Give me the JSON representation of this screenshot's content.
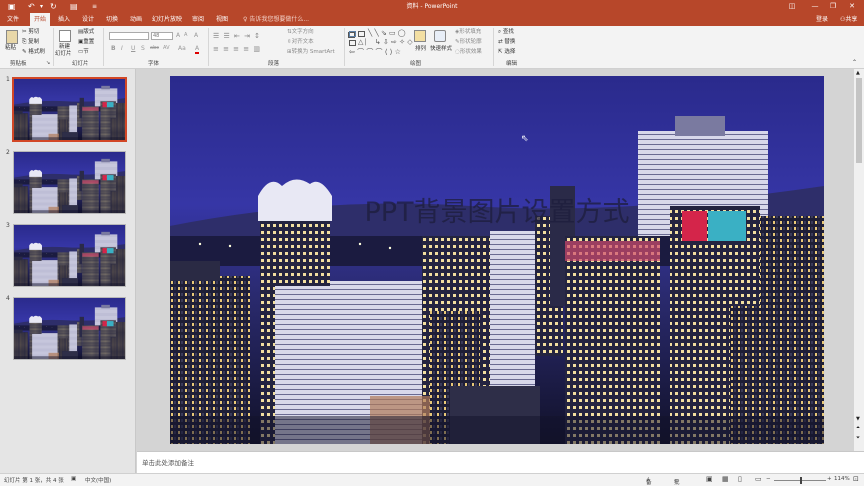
{
  "window": {
    "title": "資料 - PowerPoint"
  },
  "quick_access": {
    "save_icon": "save-icon",
    "undo_icon": "undo-icon",
    "redo_icon": "redo-icon",
    "customize_icon": "customize-icon"
  },
  "window_controls": {
    "ribbon_display": "ribbon-display-icon",
    "minimize": "minimize-icon",
    "restore": "restore-icon",
    "close": "close-icon"
  },
  "tabs": [
    {
      "label": "文件"
    },
    {
      "label": "开始"
    },
    {
      "label": "插入"
    },
    {
      "label": "设计"
    },
    {
      "label": "切换"
    },
    {
      "label": "动画"
    },
    {
      "label": "幻灯片放映"
    },
    {
      "label": "审阅"
    },
    {
      "label": "视图"
    }
  ],
  "tell_me": {
    "placeholder": "告诉我您想要做什么..."
  },
  "account": {
    "login": "登录",
    "share": "共享"
  },
  "ribbon": {
    "clipboard": {
      "paste": "粘贴",
      "cut": "剪切",
      "copy": "复制",
      "format_painter": "格式刷",
      "label": "剪贴板"
    },
    "slides": {
      "new_slide": "新建",
      "new_slide2": "幻灯片",
      "layout": "版式",
      "reset": "重置",
      "section": "节",
      "label": "幻灯片"
    },
    "font": {
      "name": "",
      "size": "48",
      "bold": "B",
      "italic": "I",
      "underline": "U",
      "strike": "S",
      "shadow": "abc",
      "spacing": "AV",
      "case": "Aa",
      "color": "A",
      "grow": "A",
      "shrink": "A",
      "clear": "A",
      "label": "字体"
    },
    "paragraph": {
      "text_direction": "文字方向",
      "align_text": "对齐文本",
      "smartart": "转换为 SmartArt",
      "label": "段落"
    },
    "drawing": {
      "arrange": "排列",
      "quick_styles": "快速样式",
      "shape_fill": "形状填充",
      "shape_outline": "形状轮廓",
      "shape_effects": "形状效果",
      "label": "绘图"
    },
    "editing": {
      "find": "查找",
      "replace": "替换",
      "select": "选择",
      "label": "编辑"
    }
  },
  "slides": [
    {
      "number": "1"
    },
    {
      "number": "2"
    },
    {
      "number": "3"
    },
    {
      "number": "4"
    }
  ],
  "slide": {
    "title": "PPT背景图片设置方式"
  },
  "notes": {
    "placeholder": "单击此处添加备注"
  },
  "status": {
    "slide_info": "幻灯片 第 1 张，共 4 张",
    "language": "中文(中国)",
    "notes": "备注",
    "comments": "批注",
    "zoom": "114%"
  },
  "colors": {
    "accent": "#b7472a",
    "selected_thumb": "#d24726"
  }
}
